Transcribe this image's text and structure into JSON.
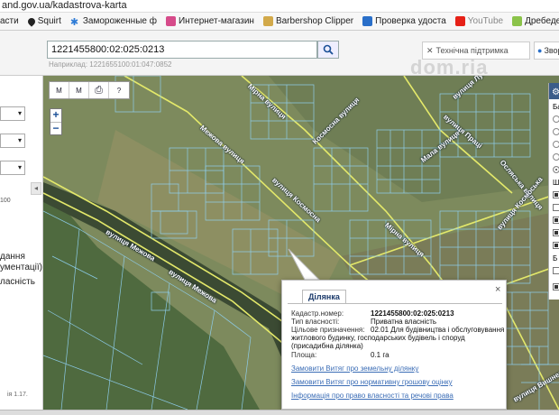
{
  "browser": {
    "url": "and.gov.ua/kadastrova-karta",
    "bookmarks": [
      {
        "label": "асти",
        "color": "#ffffff"
      },
      {
        "label": "Squirt",
        "color": "#222222"
      },
      {
        "label": "Замороженные ф",
        "color": "#2e7bd6"
      },
      {
        "label": "Интернет-магазин",
        "color": "#d64b8a"
      },
      {
        "label": "Barbershop Clipper",
        "color": "#d2a94a"
      },
      {
        "label": "Проверка удоста",
        "color": "#2a6fc9"
      },
      {
        "label": "YouTube",
        "color": "#e62117"
      },
      {
        "label": "Дребеденьки - до",
        "color": "#8bc34a"
      }
    ]
  },
  "search": {
    "value": "1221455800:02:025:0213",
    "hint": "Наприклад: 1221655100:01:047:0852"
  },
  "header": {
    "support_label": "Технічна підтримка",
    "login_label": "Звор",
    "watermark": "dom.ria"
  },
  "left_panel": {
    "selects": [
      "▾",
      "▾",
      "▾"
    ],
    "scale_text": "100",
    "texts": [
      "дання",
      "ументації)",
      "ласність"
    ],
    "version": "ія 1.17."
  },
  "map": {
    "tool_labels": [
      "М",
      "М",
      "⎙",
      "?"
    ],
    "zoom_in": "+",
    "zoom_out": "−",
    "streets": [
      "вулиця Межова",
      "вулиця Межова",
      "Межова вулиця",
      "Мірна вулиця",
      "Космосна вулиця",
      "вулиця Космосна",
      "Мірна вулиця",
      "вулиця Луговська",
      "Мала вулиця",
      "вулиця Праці",
      "Осляська вулиця",
      "вулиця Вишнева",
      "вулиця Космоська"
    ]
  },
  "layers_panel": {
    "labels": [
      "Ба",
      "Ша",
      "Б"
    ]
  },
  "popup": {
    "tab": "Ділянка",
    "close": "×",
    "fields": [
      {
        "key": "Кадастр.номер:",
        "value": "1221455800:02:025:0213"
      },
      {
        "key": "Тип власності:",
        "value": "Приватна власність"
      },
      {
        "key": "Цільове призначення:",
        "value": "02.01 Для будівництва і обслуговування"
      },
      {
        "key": "",
        "value": "житлового будинку, господарських будівель і споруд"
      },
      {
        "key": "",
        "value": "(присадибна ділянка)"
      },
      {
        "key": "Площа:",
        "value": "0.1 га"
      }
    ],
    "links": [
      "Замовити Витяг про земельну ділянку",
      "Замовити Витяг про нормативну грошову оцінку",
      "Інформація про право власності та речові права"
    ]
  }
}
